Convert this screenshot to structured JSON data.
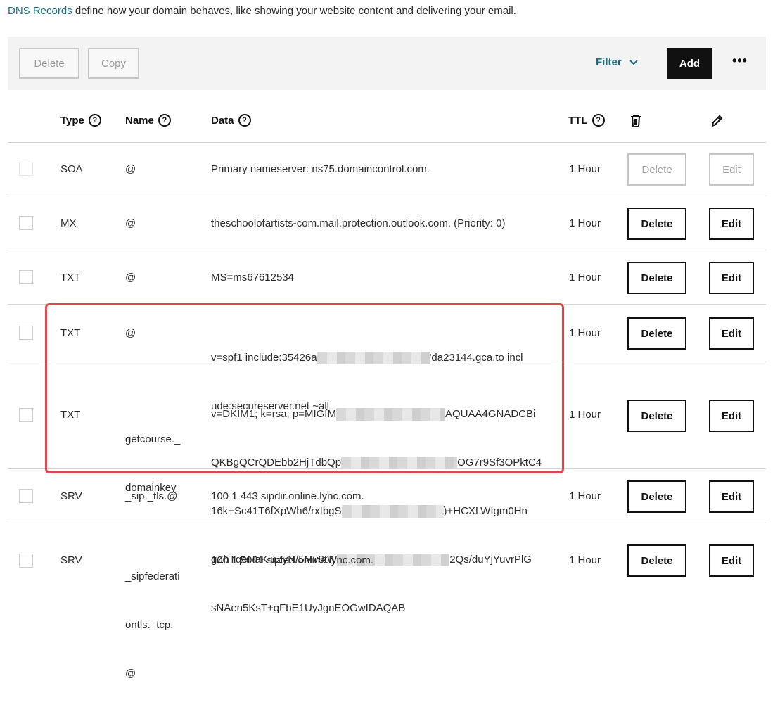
{
  "intro": {
    "link": "DNS Records",
    "text": " define how your domain behaves, like showing your website content and delivering your email."
  },
  "toolbar": {
    "delete_label": "Delete",
    "copy_label": "Copy",
    "filter_label": "Filter",
    "add_label": "Add",
    "more_label": "•••"
  },
  "columns": {
    "type": "Type",
    "name": "Name",
    "data": "Data",
    "ttl": "TTL"
  },
  "rows": [
    {
      "type": "SOA",
      "name": "@",
      "data": "Primary nameserver: ns75.domaincontrol.com.",
      "ttl": "1 Hour",
      "delete": "Delete",
      "edit": "Edit"
    },
    {
      "type": "MX",
      "name": "@",
      "data": "theschoolofartists-com.mail.protection.outlook.com. (Priority: 0)",
      "ttl": "1 Hour",
      "delete": "Delete",
      "edit": "Edit"
    },
    {
      "type": "TXT",
      "name": "@",
      "data": "MS=ms67612534",
      "ttl": "1 Hour",
      "delete": "Delete",
      "edit": "Edit"
    },
    {
      "type": "TXT",
      "name": "@",
      "data_line1_a": "v=spf1 include:35426a",
      "data_line1_b": "'da23144.gca.to incl",
      "data_line2": "ude:secureserver.net ~all",
      "ttl": "1 Hour",
      "delete": "Delete",
      "edit": "Edit"
    },
    {
      "type": "TXT",
      "name_line1": "getcourse._",
      "name_line2": "domainkey",
      "data_lines": [
        {
          "a": "v=DKIM1; k=rsa; p=MIGfM",
          "b": "AQUAA4GNADCBi"
        },
        {
          "a": "QKBgQCrQDEbb2HjTdbQp",
          "b": "OG7r9Sf3OPktC4"
        },
        {
          "a": "16k+Sc41T6fXpWh6/rxIbgS",
          "b": ")+HCXLWIgm0Hn"
        },
        {
          "a": "gZhTqeHaKiuZyN/5Mv8tW",
          "b": "2Qs/duYjYuvrPlG"
        },
        {
          "a": "sNAen5KsT+qFbE1UyJgnEOGwIDAQAB",
          "b": ""
        }
      ],
      "ttl": "1 Hour",
      "delete": "Delete",
      "edit": "Edit"
    },
    {
      "type": "SRV",
      "name": "_sip._tls.@",
      "data": "100 1 443 sipdir.online.lync.com.",
      "ttl": "1 Hour",
      "delete": "Delete",
      "edit": "Edit"
    },
    {
      "type": "SRV",
      "name_line1": "_sipfederati",
      "name_line2": "ontls._tcp.",
      "name_line3": "@",
      "data": "100 1 5061 sipfed.online.lync.com.",
      "ttl": "1 Hour",
      "delete": "Delete",
      "edit": "Edit"
    }
  ],
  "icons": {
    "help": "question-circle-icon",
    "trash": "trash-icon",
    "pencil": "pencil-icon",
    "chevron": "chevron-down-icon"
  },
  "colors": {
    "link": "#1b6f84",
    "highlight": "#e0474a",
    "primary_button": "#111111"
  }
}
